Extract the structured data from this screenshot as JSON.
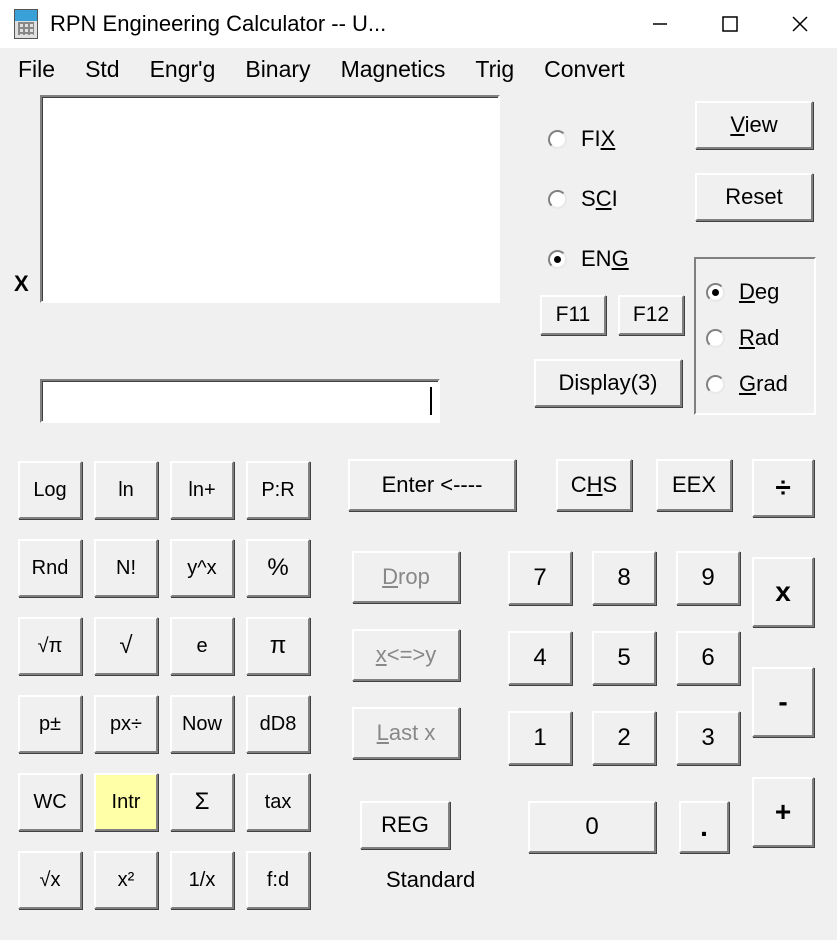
{
  "window": {
    "title": "RPN Engineering Calculator -- U...",
    "minimize_icon": "minimize",
    "maximize_icon": "maximize",
    "close_icon": "close"
  },
  "menu": {
    "file": "File",
    "std": "Std",
    "engrg": "Engr'g",
    "binary": "Binary",
    "magnetics": "Magnetics",
    "trig": "Trig",
    "convert": "Convert"
  },
  "stack": {
    "x_label": "X",
    "input_value": ""
  },
  "format_radios": {
    "fix_pre": "FI",
    "fix_ul": "X",
    "sci_pre": "S",
    "sci_ul": "C",
    "sci_post": "I",
    "eng_pre": "EN",
    "eng_ul": "G",
    "selected": "eng"
  },
  "buttons": {
    "view_ul": "V",
    "view_rest": "iew",
    "reset": "Reset",
    "f11": "F11",
    "f12": "F12",
    "display": "Display(3)",
    "enter": "Enter <----",
    "chs_pre": "C",
    "chs_ul": "H",
    "chs_post": "S",
    "eex": "EEX",
    "drop_ul": "D",
    "drop_rest": "rop",
    "swap_ul": "x",
    "swap_rest": "<=>y",
    "last_ul": "L",
    "last_rest": "ast x",
    "reg": "REG"
  },
  "angle": {
    "deg_ul": "D",
    "deg_rest": "eg",
    "rad_ul": "R",
    "rad_rest": "ad",
    "grad_ul": "G",
    "grad_rest": "rad",
    "selected": "deg"
  },
  "fn": [
    [
      "Log",
      "ln",
      "ln+",
      "P:R"
    ],
    [
      "Rnd",
      "N!",
      "y^x",
      "%"
    ],
    [
      "√π",
      "√",
      "e",
      "π"
    ],
    [
      "p±",
      "px÷",
      "Now",
      "dD8"
    ],
    [
      "WC",
      "Intr",
      "Σ",
      "tax"
    ],
    [
      "√x",
      "x²",
      "1/x",
      "f:d"
    ]
  ],
  "ops": {
    "div": "÷",
    "mul": "x",
    "sub": "-",
    "add": "+"
  },
  "numpad": {
    "7": "7",
    "8": "8",
    "9": "9",
    "4": "4",
    "5": "5",
    "6": "6",
    "1": "1",
    "2": "2",
    "3": "3",
    "0": "0",
    "dot": "."
  },
  "mode": {
    "label": "Standard"
  }
}
